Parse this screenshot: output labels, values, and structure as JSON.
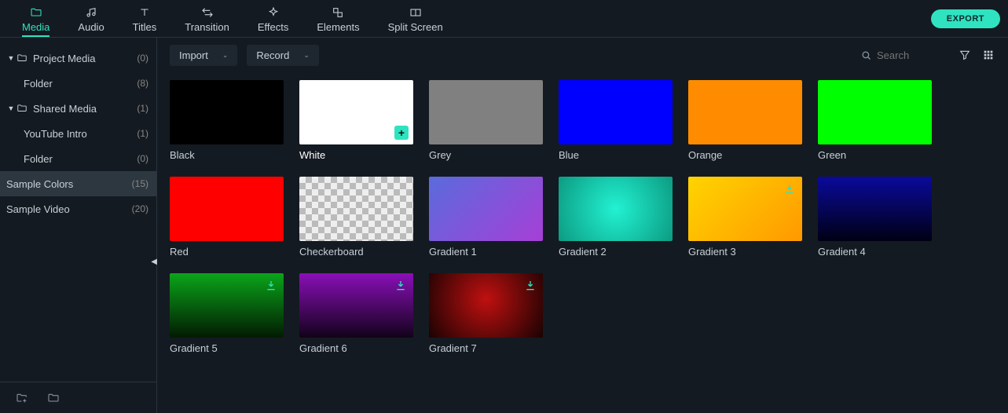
{
  "nav": {
    "tabs": [
      {
        "id": "media",
        "label": "Media",
        "icon": "folder",
        "active": true
      },
      {
        "id": "audio",
        "label": "Audio",
        "icon": "music",
        "active": false
      },
      {
        "id": "titles",
        "label": "Titles",
        "icon": "text",
        "active": false
      },
      {
        "id": "transition",
        "label": "Transition",
        "icon": "swap",
        "active": false
      },
      {
        "id": "effects",
        "label": "Effects",
        "icon": "sparkle",
        "active": false
      },
      {
        "id": "elements",
        "label": "Elements",
        "icon": "shapes",
        "active": false
      },
      {
        "id": "splitscreen",
        "label": "Split Screen",
        "icon": "split",
        "active": false
      }
    ],
    "export_label": "EXPORT"
  },
  "sidebar": {
    "items": [
      {
        "type": "parent",
        "label": "Project Media",
        "count": "(0)",
        "expanded": true,
        "has_folder_icon": true
      },
      {
        "type": "child",
        "label": "Folder",
        "count": "(8)"
      },
      {
        "type": "parent",
        "label": "Shared Media",
        "count": "(1)",
        "expanded": true,
        "has_folder_icon": true
      },
      {
        "type": "child",
        "label": "YouTube Intro",
        "count": "(1)"
      },
      {
        "type": "child",
        "label": "Folder",
        "count": "(0)"
      },
      {
        "type": "root",
        "label": "Sample Colors",
        "count": "(15)",
        "selected": true
      },
      {
        "type": "root",
        "label": "Sample Video",
        "count": "(20)"
      }
    ]
  },
  "toolbar": {
    "import_label": "Import",
    "record_label": "Record",
    "search_placeholder": "Search"
  },
  "swatches": [
    {
      "label": "Black",
      "style": "background:#000000"
    },
    {
      "label": "White",
      "style": "background:#ffffff",
      "hovered": true,
      "show_add": true
    },
    {
      "label": "Grey",
      "style": "background:#808080"
    },
    {
      "label": "Blue",
      "style": "background:#0000ff"
    },
    {
      "label": "Orange",
      "style": "background:#ff8c00"
    },
    {
      "label": "Green",
      "style": "background:#00ff00"
    },
    {
      "label": "Red",
      "style": "background:#ff0000"
    },
    {
      "label": "Checkerboard",
      "style": "background:repeating-conic-gradient(#bbb 0% 25%, #eee 0% 50%) 0 0/16px 16px"
    },
    {
      "label": "Gradient 1",
      "style": "background:linear-gradient(135deg,#5a6bdc,#a63fd6)"
    },
    {
      "label": "Gradient 2",
      "style": "background:radial-gradient(circle at 50% 50%, #22f2d2, #0c9b82)"
    },
    {
      "label": "Gradient 3",
      "style": "background:linear-gradient(135deg,#ffd400,#ff9900)",
      "show_dl": true
    },
    {
      "label": "Gradient 4",
      "style": "background:linear-gradient(180deg,#0a0a9c,#000014)"
    },
    {
      "label": "Gradient 5",
      "style": "background:linear-gradient(180deg,#0aa51a,#021b02)",
      "show_dl": true
    },
    {
      "label": "Gradient 6",
      "style": "background:linear-gradient(180deg,#8a0fb8,#12021a)",
      "show_dl": true
    },
    {
      "label": "Gradient 7",
      "style": "background:radial-gradient(circle at 50% 40%, #c01010, #1a0202)",
      "show_dl": true
    }
  ]
}
